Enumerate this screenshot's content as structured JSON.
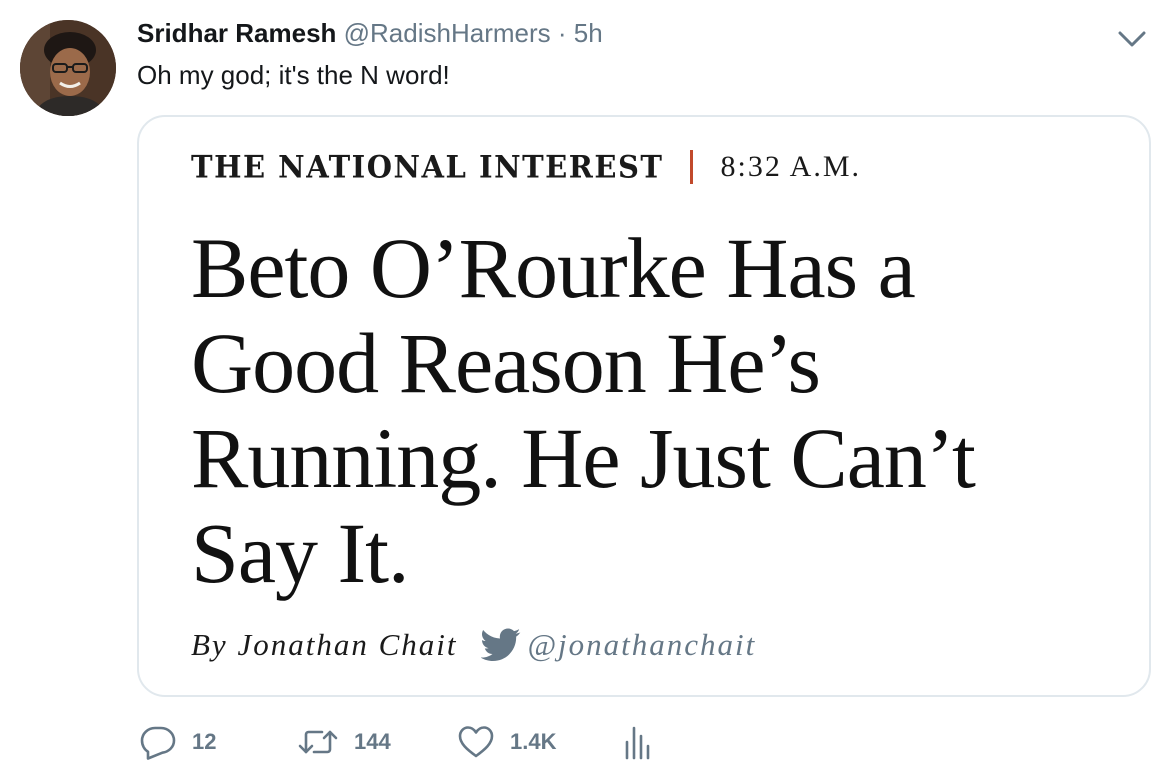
{
  "tweet": {
    "author_name": "Sridhar Ramesh",
    "author_handle": "@RadishHarmers",
    "separator": "·",
    "timestamp": "5h",
    "text": "Oh my god; it's the N word!"
  },
  "card": {
    "publication": "THE NATIONAL INTEREST",
    "time": "8:32 A.M.",
    "headline": "Beto O’Rourke Has a Good Reason He’s Running. He Just Can’t Say It.",
    "byline": "By Jonathan Chait",
    "byline_handle": "@jonathanchait",
    "accent_color": "#c1492b"
  },
  "actions": {
    "reply_count": "12",
    "retweet_count": "144",
    "like_count": "1.4K"
  },
  "icons": {
    "reply": "reply-icon",
    "retweet": "retweet-icon",
    "like": "heart-icon",
    "analytics": "analytics-icon",
    "menu": "chevron-down-icon",
    "byline_twitter": "twitter-bird-icon"
  },
  "colors": {
    "text_primary": "#14171a",
    "text_secondary": "#657786",
    "border": "#e1e8ed"
  }
}
